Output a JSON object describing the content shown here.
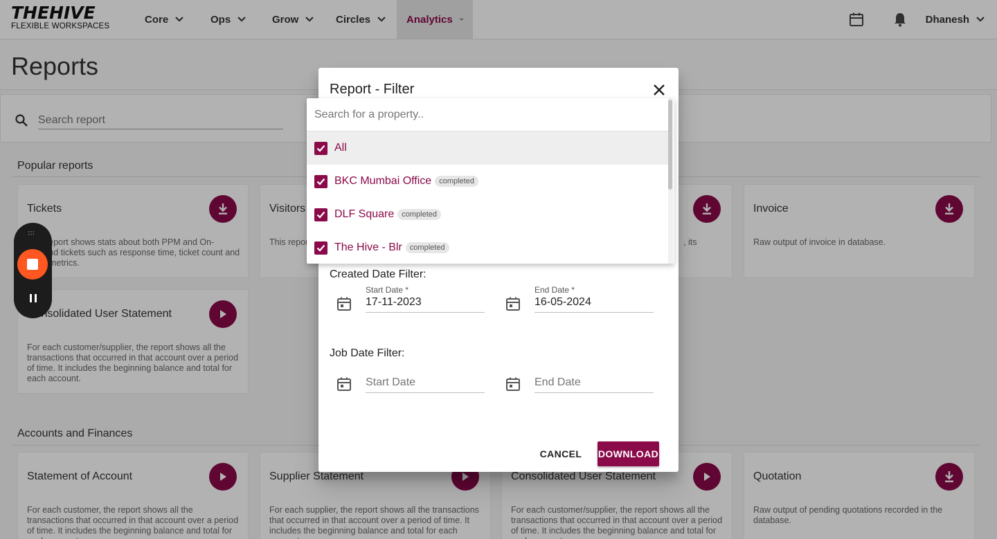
{
  "nav": {
    "logo_main": "THEHIVE",
    "logo_sub": "FLEXIBLE WORKSPACES",
    "items": [
      {
        "label": "Core"
      },
      {
        "label": "Ops"
      },
      {
        "label": "Grow"
      },
      {
        "label": "Circles"
      },
      {
        "label": "Analytics"
      }
    ],
    "active": "Analytics",
    "user": "Dhanesh"
  },
  "page": {
    "title": "Reports",
    "search_placeholder": "Search report"
  },
  "sections": {
    "popular": "Popular reports",
    "accounts": "Accounts and Finances"
  },
  "popular_cards": [
    {
      "title": "Tickets",
      "desc": "This report shows stats about both PPM and On-demand tickets such as response time, ticket count and other metrics.",
      "action": "download-icon"
    },
    {
      "title": "Visitors",
      "desc": "This report shows the visitors for each property, with",
      "action": "download-icon"
    },
    {
      "title": "",
      "desc": "",
      "action": "download-icon"
    },
    {
      "title": "Invoice",
      "desc": "Raw output of invoice in database.",
      "action": "download-icon"
    },
    {
      "title": "Consolidated User Statement",
      "desc": "For each customer/supplier, the report shows all the transactions that occurred in that account over a period of time. It includes the beginning balance and total for each account.",
      "action": "play-icon"
    }
  ],
  "partial_text": {
    "card3_tail": ", its"
  },
  "account_cards": [
    {
      "title": "Statement of Account",
      "desc": "For each customer, the report shows all the transactions that occurred in that account over a period of time. It includes the beginning balance and total for each account.",
      "action": "play-icon"
    },
    {
      "title": "Supplier Statement",
      "desc": "For each supplier, the report shows all the transactions that occurred in that account over a period of time. It includes the beginning balance and total for each account.",
      "action": "play-icon"
    },
    {
      "title": "Consolidated User Statement",
      "desc": "For each customer/supplier, the report shows all the transactions that occurred in that account over a period of time. It includes the beginning balance and total for each account.",
      "action": "play-icon"
    },
    {
      "title": "Quotation",
      "desc": "Raw output of pending quotations recorded in the database.",
      "action": "download-icon"
    }
  ],
  "dialog": {
    "title": "Report - Filter",
    "property_search_placeholder": "Search for a property..",
    "properties": [
      {
        "name": "All",
        "checked": true,
        "badge": ""
      },
      {
        "name": "BKC Mumbai Office",
        "checked": true,
        "badge": "completed"
      },
      {
        "name": "DLF Square",
        "checked": true,
        "badge": "completed"
      },
      {
        "name": "The Hive - Blr",
        "checked": true,
        "badge": "completed"
      }
    ],
    "created_filter_label": "Created Date Filter:",
    "created_start_label": "Start Date *",
    "created_start_value": "17-11-2023",
    "created_end_label": "End Date *",
    "created_end_value": "16-05-2024",
    "job_filter_label": "Job Date Filter:",
    "job_start_placeholder": "Start Date",
    "job_end_placeholder": "End Date",
    "cancel_label": "CANCEL",
    "download_label": "DOWNLOAD"
  },
  "colors": {
    "brand": "#8a0a4a",
    "recorder_stop": "#ff5722"
  }
}
